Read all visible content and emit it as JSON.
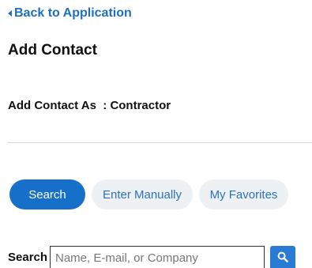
{
  "nav": {
    "back_label": "Back to Application"
  },
  "page": {
    "title": "Add Contact",
    "contact_as": "Add Contact As  : Contractor"
  },
  "tabs": [
    {
      "label": "Search",
      "active": true
    },
    {
      "label": "Enter Manually",
      "active": false
    },
    {
      "label": "My Favorites",
      "active": false
    }
  ],
  "search": {
    "label": "Search",
    "value": "",
    "placeholder": "Name, E-mail, or Company",
    "button_icon": "search-icon"
  },
  "colors": {
    "link": "#1e6fbd",
    "primary": "#1670c9",
    "tab_inactive_bg": "#eef1f4",
    "search_button": "#2a7bd3"
  }
}
